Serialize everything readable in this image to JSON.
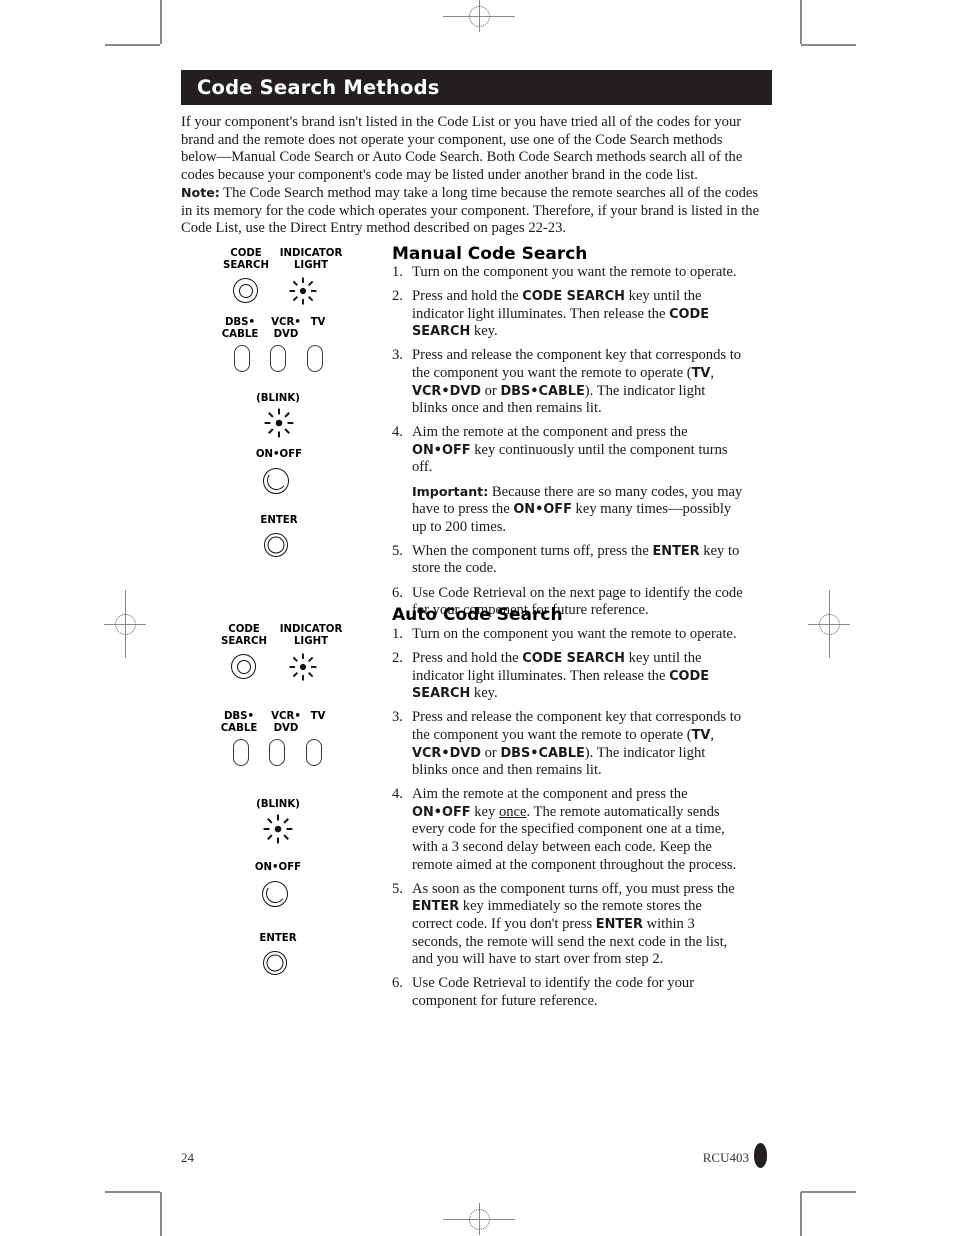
{
  "document": {
    "title": "Code Search Methods",
    "intro": "If your component's brand isn't listed in the Code List or you have tried all of the codes for your brand and the remote does not operate your component, use one of the Code Search methods below—Manual Code Search or Auto Code Search. Both Code Search methods search all of the codes because your component's code may be listed under another brand in the code list.",
    "note_label": "Note:",
    "note_text": " The Code Search method may take a long time because the remote searches all of the codes in its memory for the code which operates your component. Therefore, if your brand is listed in the Code List, use the Direct Entry method described on pages 22-23."
  },
  "manual": {
    "heading": "Manual Code Search",
    "steps": [
      {
        "num": "1.",
        "html": "Turn on the component you want the remote to operate."
      },
      {
        "num": "2.",
        "html": "Press and hold the <span class=\"k\">CODE SEARCH</span> key until the indicator light illuminates. Then release the <span class=\"k\">CODE SEARCH</span> key."
      },
      {
        "num": "3.",
        "html": "Press and release the component key that corresponds to the component you want the remote to operate (<span class=\"k\">TV</span>, <span class=\"k\">VCR•DVD</span> or <span class=\"k\">DBS•CABLE</span>). The indicator light blinks once and then remains lit."
      },
      {
        "num": "4.",
        "html": "Aim the remote at the component and press the <span class=\"k\">ON•OFF</span> key continuously until the component turns off."
      }
    ],
    "important": "<span class=\"nb\">Important:</span> Because there are so many codes, you may have to press the <span class=\"k\">ON•OFF</span> key many times—possibly up to 200 times.",
    "steps_after": [
      {
        "num": "5.",
        "html": "When the component turns off, press the <span class=\"k\">ENTER</span> key to store the code."
      },
      {
        "num": "6.",
        "html": "Use Code Retrieval on the next page to identify the code for your component for future reference."
      }
    ]
  },
  "auto": {
    "heading": "Auto Code Search",
    "steps": [
      {
        "num": "1.",
        "html": "Turn on the component you want the remote to operate."
      },
      {
        "num": "2.",
        "html": "Press and hold the <span class=\"k\">CODE SEARCH</span> key until the indicator light illuminates. Then release the <span class=\"k\">CODE SEARCH</span> key."
      },
      {
        "num": "3.",
        "html": "Press and release the component key that corresponds to the component you want the remote to operate (<span class=\"k\">TV</span>, <span class=\"k\">VCR•DVD</span> or <span class=\"k\">DBS•CABLE</span>). The indicator light blinks once and then remains lit."
      },
      {
        "num": "4.",
        "html": "Aim the remote at the component and press the <span class=\"k\">ON•OFF</span> key <span class=\"u\">once</span>. The remote automatically sends every code for the specified component one at a time, with a 3 second delay between each code. Keep the remote aimed at the component throughout the process."
      },
      {
        "num": "5.",
        "html": "As soon as the component turns off, you must press the <span class=\"k\">ENTER</span> key immediately so the remote stores the correct code. If you don't press <span class=\"k\">ENTER</span> within 3 seconds, the remote will send the next code in the list, and you will have to start over from step 2."
      },
      {
        "num": "6.",
        "html": "Use Code Retrieval to identify the code for your component for future reference."
      }
    ]
  },
  "diagram": {
    "code_search_label": "CODE\nSEARCH",
    "code_search_line1": "CODE",
    "code_search_line2": "SEARCH",
    "indicator_light_line1": "INDICATOR",
    "indicator_light_line2": "LIGHT",
    "dbs_cable_line1": "DBS•",
    "dbs_cable_line2": "CABLE",
    "vcr_dvd_line1": "VCR•",
    "vcr_dvd_line2": "DVD",
    "tv_label": "TV",
    "blink_label": "(BLINK)",
    "onoff_label": "ON•OFF",
    "enter_label": "ENTER"
  },
  "footer": {
    "page_number": "24",
    "model": "RCU403"
  },
  "colors": {
    "title_bar_bg": "#231f20",
    "title_text": "#ffffff",
    "body_text": "#1a1a1a",
    "crop_mark": "#8a8a8a"
  }
}
